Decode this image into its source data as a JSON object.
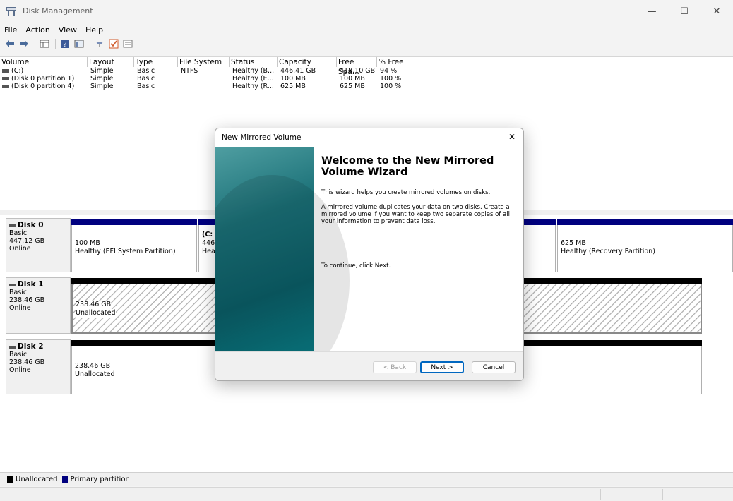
{
  "window": {
    "title": "Disk Management",
    "minimize": "—",
    "maximize": "☐",
    "close": "✕"
  },
  "menu": [
    "File",
    "Action",
    "View",
    "Help"
  ],
  "columns": [
    "Volume",
    "Layout",
    "Type",
    "File System",
    "Status",
    "Capacity",
    "Free Spa...",
    "% Free"
  ],
  "volumes": [
    [
      "(C:)",
      "Simple",
      "Basic",
      "NTFS",
      "Healthy (B...",
      "446.41 GB",
      "418.10 GB",
      "94 %"
    ],
    [
      "(Disk 0 partition 1)",
      "Simple",
      "Basic",
      "",
      "Healthy (E...",
      "100 MB",
      "100 MB",
      "100 %"
    ],
    [
      "(Disk 0 partition 4)",
      "Simple",
      "Basic",
      "",
      "Healthy (R...",
      "625 MB",
      "625 MB",
      "100 %"
    ]
  ],
  "disks": {
    "disk0": {
      "name": "Disk 0",
      "type": "Basic",
      "size": "447.12 GB",
      "state": "Online",
      "p1_size": "100 MB",
      "p1_status": "Healthy (EFI System Partition)",
      "p2_name": "(C:",
      "p2_size": "446",
      "p2_status": "Hea",
      "p3_size": "625 MB",
      "p3_status": "Healthy (Recovery Partition)"
    },
    "disk1": {
      "name": "Disk 1",
      "type": "Basic",
      "size": "238.46 GB",
      "state": "Online",
      "u_size": "238.46 GB",
      "u_label": "Unallocated"
    },
    "disk2": {
      "name": "Disk 2",
      "type": "Basic",
      "size": "238.46 GB",
      "state": "Online",
      "u_size": "238.46 GB",
      "u_label": "Unallocated"
    }
  },
  "legend": {
    "unallocated": "Unallocated",
    "primary": "Primary partition"
  },
  "colors": {
    "primary": "#00007f",
    "unallocated": "#000000",
    "accent": "#0067c0"
  },
  "dialog": {
    "title": "New Mirrored Volume",
    "close": "✕",
    "heading": "Welcome to the New Mirrored Volume Wizard",
    "p1": "This wizard helps you create mirrored volumes on disks.",
    "p2": "A mirrored volume duplicates your data on two disks. Create a mirrored volume if you want to keep two separate copies of all your information to prevent  data loss.",
    "p3": "To continue, click Next.",
    "back": "< Back",
    "next": "Next >",
    "cancel": "Cancel"
  }
}
